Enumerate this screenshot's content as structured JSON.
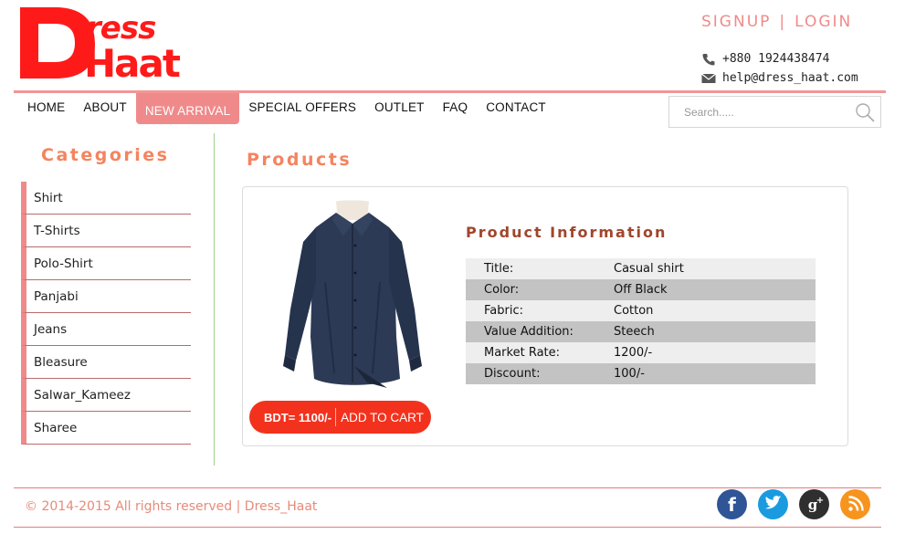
{
  "header": {
    "logo_text": "Dress Haat",
    "signup_label": "SIGNUP",
    "auth_separator": "|",
    "login_label": "LOGIN",
    "phone": "+880 1924438474",
    "email": "help@dress_haat.com"
  },
  "nav": {
    "items": [
      {
        "label": "HOME"
      },
      {
        "label": "ABOUT"
      },
      {
        "label": "NEW ARRIVAL",
        "active": true
      },
      {
        "label": "SPECIAL OFFERS"
      },
      {
        "label": "OUTLET"
      },
      {
        "label": "FAQ"
      },
      {
        "label": "CONTACT"
      }
    ]
  },
  "search": {
    "placeholder": "Search....."
  },
  "sidebar": {
    "title": "Categories",
    "items": [
      {
        "label": "Shirt"
      },
      {
        "label": "T-Shirts"
      },
      {
        "label": "Polo-Shirt"
      },
      {
        "label": "Panjabi"
      },
      {
        "label": "Jeans"
      },
      {
        "label": "Bleasure"
      },
      {
        "label": "Salwar_Kameez"
      },
      {
        "label": "Sharee"
      }
    ]
  },
  "products": {
    "title": "Products",
    "price": "BDT= 1100/-",
    "add_to_cart": "ADD TO CART",
    "info_title": "Product Information",
    "info": [
      {
        "key": "Title:",
        "value": "Casual shirt"
      },
      {
        "key": "Color:",
        "value": "Off Black"
      },
      {
        "key": "Fabric:",
        "value": "Cotton"
      },
      {
        "key": "Value Addition:",
        "value": "Steech"
      },
      {
        "key": "Market Rate:",
        "value": "1200/-"
      },
      {
        "key": "Discount:",
        "value": "100/-"
      }
    ]
  },
  "footer": {
    "copyright": "© 2014-2015 All rights reserved | Dress_Haat",
    "social": [
      {
        "name": "facebook-icon",
        "glyph": "f",
        "color": "#3b5998"
      },
      {
        "name": "twitter-icon",
        "glyph": "t",
        "color": "#1da1f2"
      },
      {
        "name": "google-plus-icon",
        "glyph": "g+",
        "color": "#333333"
      },
      {
        "name": "rss-icon",
        "glyph": "rss",
        "color": "#f7941d"
      }
    ]
  },
  "colors": {
    "brand_red": "#ff0000",
    "accent_pink": "#f08a8a",
    "accent_orange": "#f4845f",
    "cart_red": "#f3321e"
  }
}
